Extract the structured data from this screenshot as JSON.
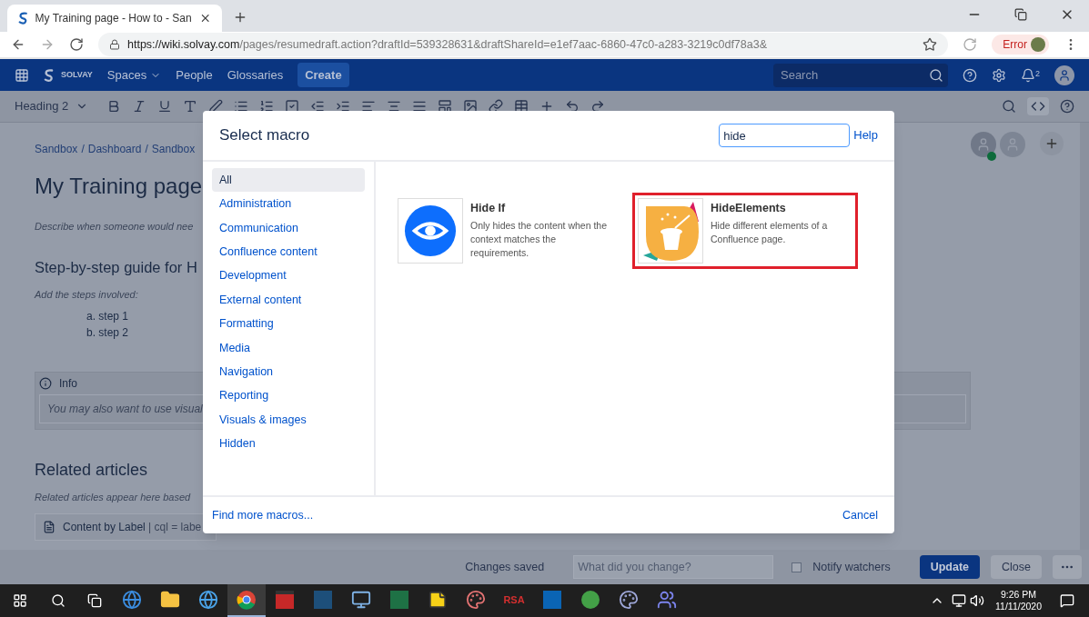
{
  "browser": {
    "tab_title": "My Training page - How to - San",
    "url_host": "https://wiki.solvay.com",
    "url_path": "/pages/resumedraft.action?draftId=539328631&draftShareId=e1ef7aac-6860-47c0-a283-3219c0df78a3&",
    "error_label": "Error"
  },
  "nav": {
    "logo": "SOLVAY",
    "items": [
      "Spaces",
      "People",
      "Glossaries"
    ],
    "create": "Create",
    "search_placeholder": "Search",
    "notification_count": "2"
  },
  "toolbar": {
    "style": "Heading 2"
  },
  "page": {
    "breadcrumbs": [
      "Sandbox",
      "Dashboard",
      "Sandbox"
    ],
    "separator": "/",
    "title": "My Training page",
    "description": "Describe when someone would nee",
    "guide_heading": "Step-by-step guide for H",
    "steps_intro": "Add the steps involved:",
    "steps": [
      "a. step 1",
      "b. step 2"
    ],
    "info_title": "Info",
    "info_text": "You may also want to use visual",
    "related_heading": "Related articles",
    "related_text": "Related articles appear here based",
    "macro_name": "Content by Label",
    "macro_params": "| cql = labe"
  },
  "dialog": {
    "title": "Select macro",
    "search_value": "hide",
    "help": "Help",
    "categories": [
      {
        "label": "All",
        "selected": true
      },
      {
        "label": "Administration",
        "selected": false
      },
      {
        "label": "Communication",
        "selected": false
      },
      {
        "label": "Confluence content",
        "selected": false
      },
      {
        "label": "Development",
        "selected": false
      },
      {
        "label": "External content",
        "selected": false
      },
      {
        "label": "Formatting",
        "selected": false
      },
      {
        "label": "Media",
        "selected": false
      },
      {
        "label": "Navigation",
        "selected": false
      },
      {
        "label": "Reporting",
        "selected": false
      },
      {
        "label": "Visuals & images",
        "selected": false
      },
      {
        "label": "Hidden",
        "selected": false
      }
    ],
    "macros": [
      {
        "kind": "eye",
        "name": "Hide If",
        "description": "Only hides the content when the context matches the requirements.",
        "highlighted": false
      },
      {
        "kind": "magic",
        "name": "HideElements",
        "description": "Hide different elements of a Confluence page.",
        "highlighted": true
      }
    ],
    "find_more": "Find more macros...",
    "cancel": "Cancel"
  },
  "bottom_bar": {
    "status": "Changes saved",
    "comment_placeholder": "What did you change?",
    "notify_label": "Notify watchers",
    "notify_checked": false,
    "update": "Update",
    "close": "Close"
  },
  "taskbar": {
    "apps": [
      {
        "kind": "edge",
        "active": false
      },
      {
        "kind": "folder",
        "active": false
      },
      {
        "kind": "ie",
        "active": false
      },
      {
        "kind": "chrome",
        "active": true
      },
      {
        "kind": "red",
        "active": false
      },
      {
        "kind": "blue",
        "active": false
      },
      {
        "kind": "monitor",
        "active": false
      },
      {
        "kind": "excel",
        "active": false
      },
      {
        "kind": "note",
        "active": false
      },
      {
        "kind": "paint",
        "active": false
      },
      {
        "kind": "rsa",
        "label": "RSA",
        "active": false
      },
      {
        "kind": "outlook",
        "active": false
      },
      {
        "kind": "green",
        "active": false
      },
      {
        "kind": "palette",
        "active": false
      },
      {
        "kind": "teams",
        "active": false
      }
    ],
    "time": "9:26 PM",
    "date": "11/11/2020"
  }
}
